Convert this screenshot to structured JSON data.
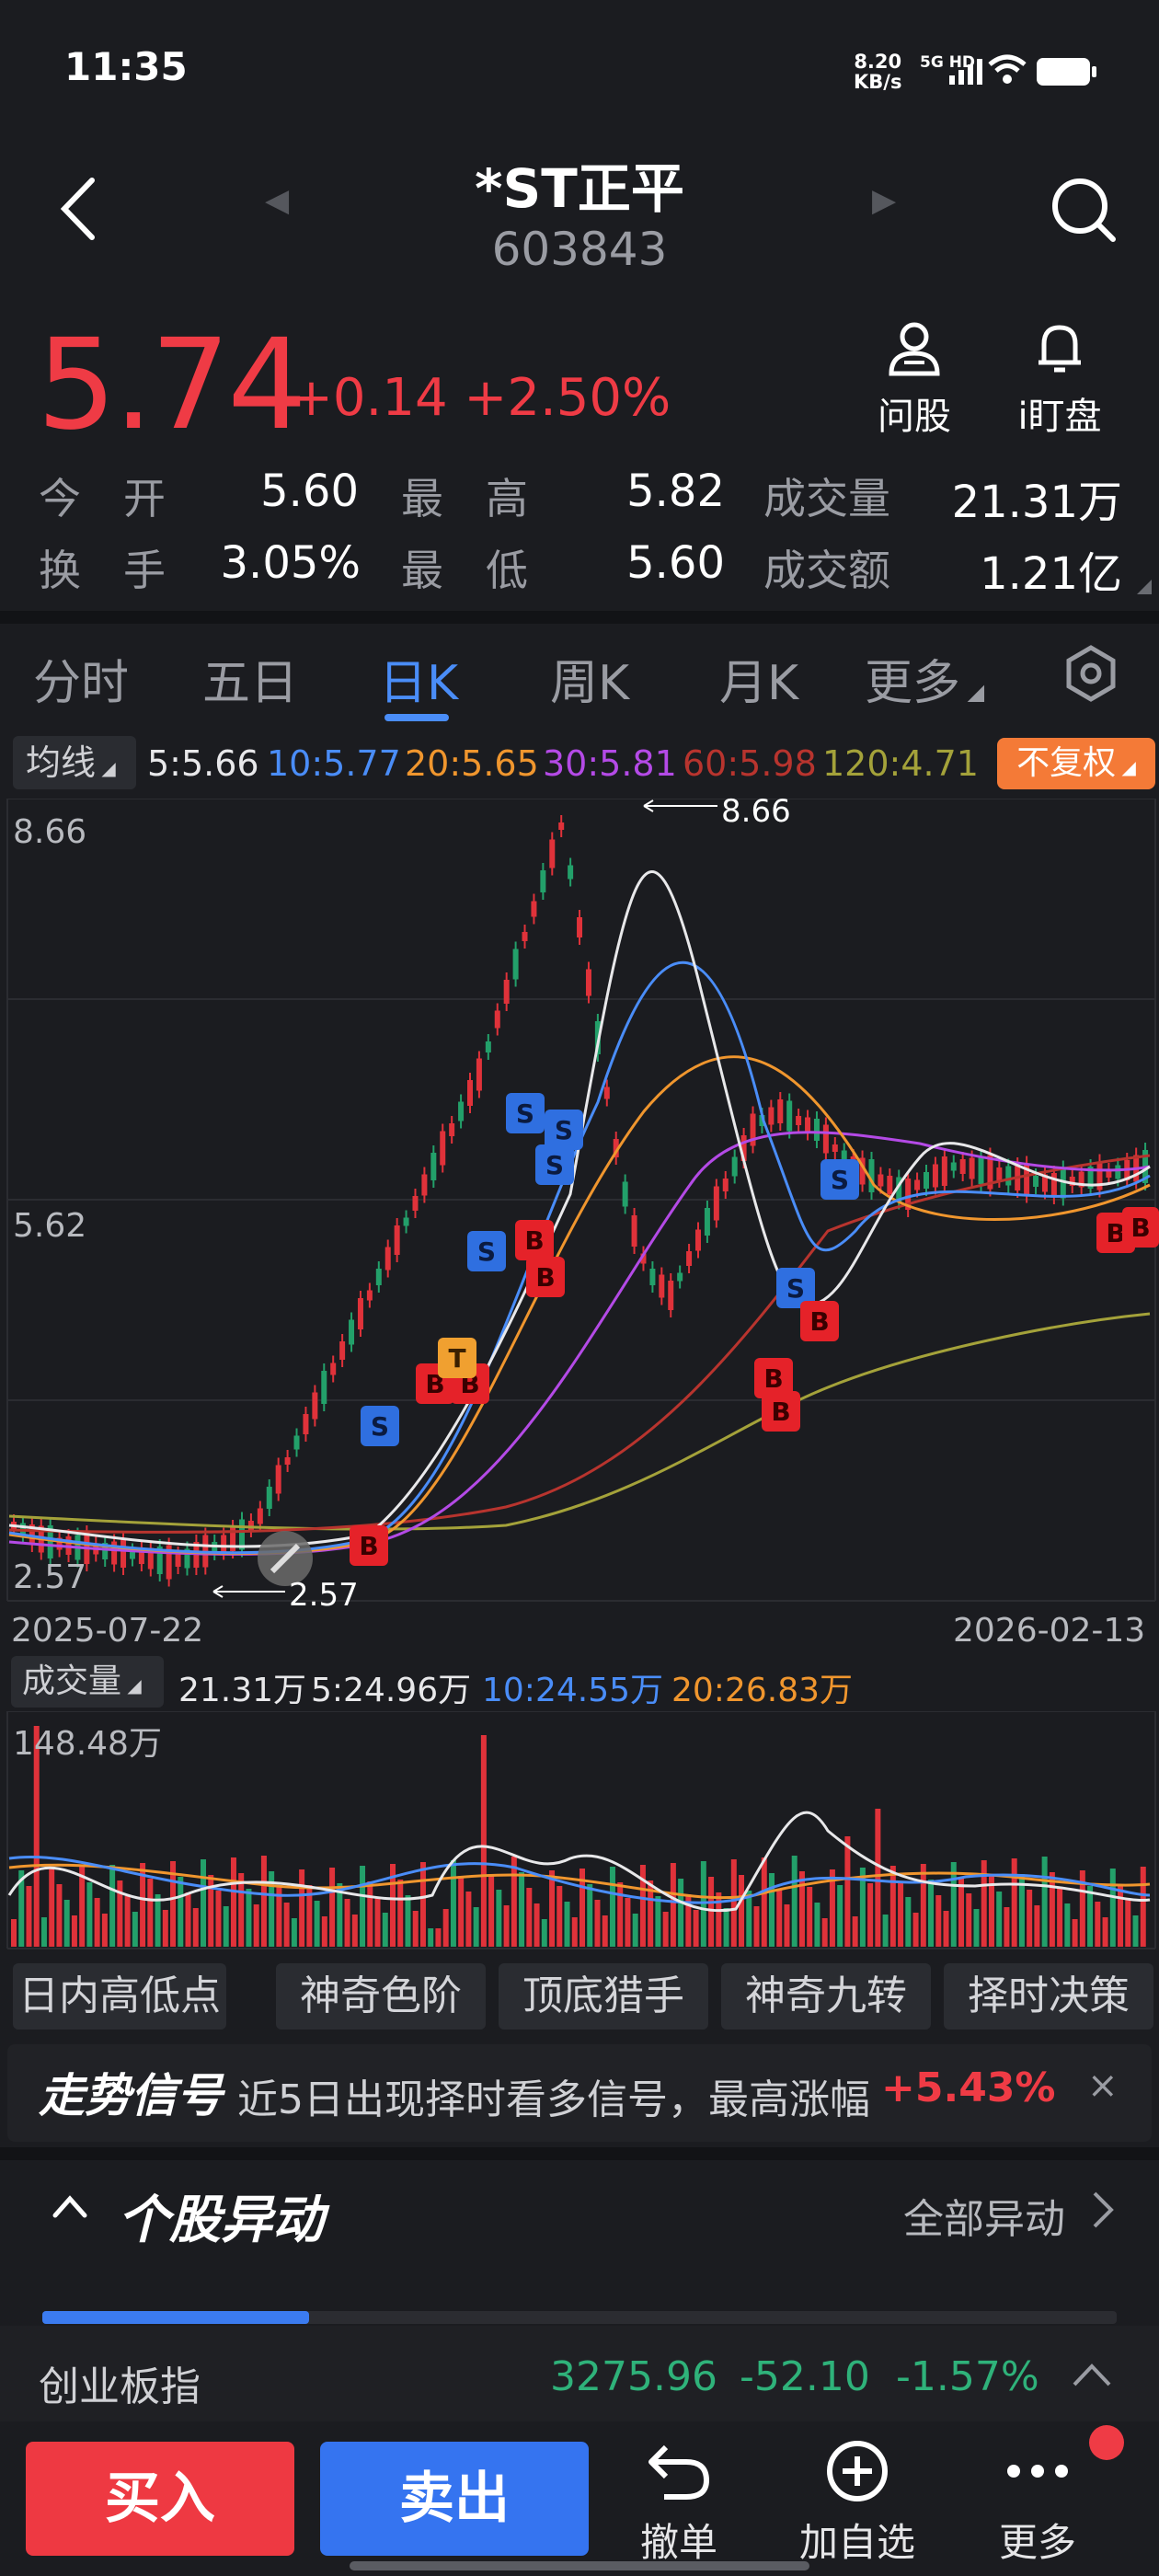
{
  "status": {
    "time": "11:35",
    "net_speed": "8.20",
    "net_unit": "KB/s",
    "signal": "5G HD"
  },
  "header": {
    "name": "*ST正平",
    "code": "603843"
  },
  "quote": {
    "price": "5.74",
    "change": "+0.14 +2.50%",
    "rows": [
      [
        {
          "label": "今　开",
          "value": "5.60",
          "color": "#ffffff"
        },
        {
          "label": "最　高",
          "value": "5.82",
          "color": "#ef3b45"
        },
        {
          "label": "成交量",
          "value": "21.31万",
          "color": "#ffffff"
        }
      ],
      [
        {
          "label": "换　手",
          "value": "3.05%",
          "color": "#ffffff"
        },
        {
          "label": "最　低",
          "value": "5.60",
          "color": "#ffffff"
        },
        {
          "label": "成交额",
          "value": "1.21亿",
          "color": "#ffffff"
        }
      ]
    ],
    "tools": {
      "ask": "问股",
      "watch": "i盯盘"
    }
  },
  "tabs": [
    "分时",
    "五日",
    "日K",
    "周K",
    "月K",
    "更多"
  ],
  "active_tab": "日K",
  "ma_legend": {
    "select": "均线",
    "items": [
      {
        "label": "5:5.66",
        "color": "#e8e8ea"
      },
      {
        "label": "10:5.77",
        "color": "#4a8df8"
      },
      {
        "label": "20:5.65",
        "color": "#f0962e"
      },
      {
        "label": "30:5.81",
        "color": "#b44ae6"
      },
      {
        "label": "60:5.98",
        "color": "#b8342e"
      },
      {
        "label": "120:4.71",
        "color": "#a4a23a"
      }
    ],
    "adjust": "不复权"
  },
  "kchart": {
    "y_top": "8.66",
    "y_mid": "5.62",
    "y_bottom": "2.57",
    "high_marker": "8.66",
    "low_marker": "2.57",
    "date_start": "2025-07-22",
    "date_end": "2026-02-13"
  },
  "volume": {
    "select": "成交量",
    "items": [
      {
        "label": "21.31万",
        "color": "#e8e8ea"
      },
      {
        "label": "5:24.96万",
        "color": "#e8e8ea"
      },
      {
        "label": "10:24.55万",
        "color": "#4a8df8"
      },
      {
        "label": "20:26.83万",
        "color": "#f0962e"
      }
    ],
    "max_label": "148.48万"
  },
  "indicators": [
    "日内高低点",
    "神奇色阶",
    "顶底猎手",
    "神奇九转",
    "择时决策"
  ],
  "signal": {
    "title": "走势信号",
    "text": "近5日出现择时看多信号，最高涨幅",
    "pct": "+5.43%",
    "close": "×"
  },
  "abnormal": {
    "title": "个股异动",
    "all": "全部异动"
  },
  "index_bar": {
    "name": "创业板指",
    "value": "3275.96",
    "change": "-52.10",
    "pct": "-1.57%"
  },
  "bottom": {
    "buy": "买入",
    "sell": "卖出",
    "cancel": "撤单",
    "add": "加自选",
    "more": "更多"
  }
}
